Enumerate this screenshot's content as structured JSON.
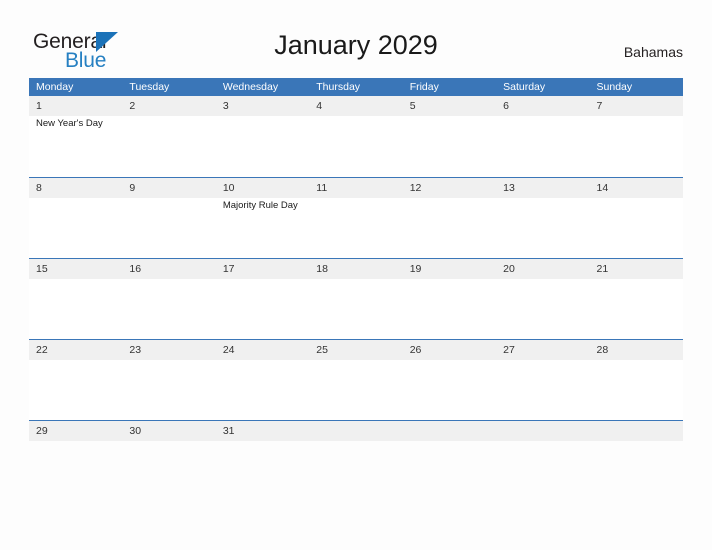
{
  "brand": {
    "name_part1": "General",
    "name_part2": "Blue",
    "triangle_color": "#1b72b8",
    "blue_color": "#2680c2"
  },
  "header": {
    "title": "January 2029",
    "country": "Bahamas"
  },
  "theme": {
    "header_bar_color": "#3a76b8",
    "row_divider_color": "#3a76b8",
    "date_band_color": "#f0f0f0",
    "page_background": "#fdfdfd"
  },
  "calendar": {
    "month": "January",
    "year": "2029",
    "weekday_headers": [
      "Monday",
      "Tuesday",
      "Wednesday",
      "Thursday",
      "Friday",
      "Saturday",
      "Sunday"
    ],
    "weeks": [
      [
        {
          "day": "1",
          "holiday": "New Year's Day"
        },
        {
          "day": "2",
          "holiday": ""
        },
        {
          "day": "3",
          "holiday": ""
        },
        {
          "day": "4",
          "holiday": ""
        },
        {
          "day": "5",
          "holiday": ""
        },
        {
          "day": "6",
          "holiday": ""
        },
        {
          "day": "7",
          "holiday": ""
        }
      ],
      [
        {
          "day": "8",
          "holiday": ""
        },
        {
          "day": "9",
          "holiday": ""
        },
        {
          "day": "10",
          "holiday": "Majority Rule Day"
        },
        {
          "day": "11",
          "holiday": ""
        },
        {
          "day": "12",
          "holiday": ""
        },
        {
          "day": "13",
          "holiday": ""
        },
        {
          "day": "14",
          "holiday": ""
        }
      ],
      [
        {
          "day": "15",
          "holiday": ""
        },
        {
          "day": "16",
          "holiday": ""
        },
        {
          "day": "17",
          "holiday": ""
        },
        {
          "day": "18",
          "holiday": ""
        },
        {
          "day": "19",
          "holiday": ""
        },
        {
          "day": "20",
          "holiday": ""
        },
        {
          "day": "21",
          "holiday": ""
        }
      ],
      [
        {
          "day": "22",
          "holiday": ""
        },
        {
          "day": "23",
          "holiday": ""
        },
        {
          "day": "24",
          "holiday": ""
        },
        {
          "day": "25",
          "holiday": ""
        },
        {
          "day": "26",
          "holiday": ""
        },
        {
          "day": "27",
          "holiday": ""
        },
        {
          "day": "28",
          "holiday": ""
        }
      ],
      [
        {
          "day": "29",
          "holiday": ""
        },
        {
          "day": "30",
          "holiday": ""
        },
        {
          "day": "31",
          "holiday": ""
        },
        {
          "day": "",
          "holiday": ""
        },
        {
          "day": "",
          "holiday": ""
        },
        {
          "day": "",
          "holiday": ""
        },
        {
          "day": "",
          "holiday": ""
        }
      ]
    ]
  }
}
